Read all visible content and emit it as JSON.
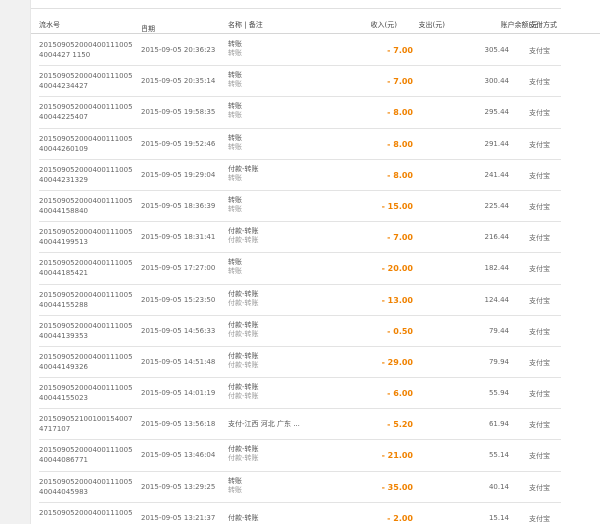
{
  "header": {
    "id": "流水号",
    "date": "日期",
    "name": "名称 | 备注",
    "income": "收入(元)",
    "expense": "支出(元)",
    "balance": "账户余额(元)",
    "payment": "支付方式"
  },
  "rows": [
    {
      "id": "2015090520004001110054004427 1150",
      "date": "2015-09-05 20:36:23",
      "name1": "转账",
      "name2": "转账",
      "out": "- 7.00",
      "bal": "305.44",
      "pay": "支付宝"
    },
    {
      "id": "201509052000400111005 40044234427",
      "date": "2015-09-05 20:35:14",
      "name1": "转账",
      "name2": "转账",
      "out": "- 7.00",
      "bal": "300.44",
      "pay": "支付宝"
    },
    {
      "id": "201509052000400111005 40044225407",
      "date": "2015-09-05 19:58:35",
      "name1": "转账",
      "name2": "转账",
      "out": "- 8.00",
      "bal": "295.44",
      "pay": "支付宝"
    },
    {
      "id": "201509052000400111005 40044260109",
      "date": "2015-09-05 19:52:46",
      "name1": "转账",
      "name2": "转账",
      "out": "- 8.00",
      "bal": "291.44",
      "pay": "支付宝"
    },
    {
      "id": "201509052000400111005 40044231329",
      "date": "2015-09-05 19:29:04",
      "name1": "付款-转账",
      "name2": "转账",
      "out": "- 8.00",
      "bal": "241.44",
      "pay": "支付宝"
    },
    {
      "id": "201509052000400111005 40044158840",
      "date": "2015-09-05 18:36:39",
      "name1": "转账",
      "name2": "转账",
      "out": "- 15.00",
      "bal": "225.44",
      "pay": "支付宝"
    },
    {
      "id": "201509052000400111005 40044199513",
      "date": "2015-09-05 18:31:41",
      "name1": "付款-转账",
      "name2": "付款-转账",
      "out": "- 7.00",
      "bal": "216.44",
      "pay": "支付宝"
    },
    {
      "id": "201509052000400111005 40044185421",
      "date": "2015-09-05 17:27:00",
      "name1": "转账",
      "name2": "转账",
      "out": "- 20.00",
      "bal": "182.44",
      "pay": "支付宝"
    },
    {
      "id": "201509052000400111005 40044155288",
      "date": "2015-09-05 15:23:50",
      "name1": "付款-转账",
      "name2": "付款-转账",
      "out": "- 13.00",
      "bal": "124.44",
      "pay": "支付宝"
    },
    {
      "id": "201509052000400111005 40044139353",
      "date": "2015-09-05 14:56:33",
      "name1": "付款-转账",
      "name2": "付款-转账",
      "out": "- 0.50",
      "bal": "79.44",
      "pay": "支付宝"
    },
    {
      "id": "201509052000400111005 40044149326",
      "date": "2015-09-05 14:51:48",
      "name1": "付款-转账",
      "name2": "付款-转账",
      "out": "- 29.00",
      "bal": "79.94",
      "pay": "支付宝"
    },
    {
      "id": "201509052000400111005 40044155023",
      "date": "2015-09-05 14:01:19",
      "name1": "付款-转账",
      "name2": "付款-转账",
      "out": "- 6.00",
      "bal": "55.94",
      "pay": "支付宝"
    },
    {
      "id": "201509052100100154007 4717107",
      "date": "2015-09-05 13:56:18",
      "name1": "支付-江西 河北 广东 ...",
      "name2": "",
      "out": "- 5.20",
      "bal": "61.94",
      "pay": "支付宝"
    },
    {
      "id": "201509052000400111005 40044086771",
      "date": "2015-09-05 13:46:04",
      "name1": "付款-转账",
      "name2": "付款-转账",
      "out": "- 21.00",
      "bal": "55.14",
      "pay": "支付宝"
    },
    {
      "id": "201509052000400111005 40044045983",
      "date": "2015-09-05 13:29:25",
      "name1": "转账",
      "name2": "转账",
      "out": "- 35.00",
      "bal": "40.14",
      "pay": "支付宝"
    },
    {
      "id": "201509052000400111005",
      "date": "2015-09-05 13:21:37",
      "name1": "付款-转账",
      "name2": "",
      "out": "- 2.00",
      "bal": "15.14",
      "pay": "支付宝"
    }
  ]
}
